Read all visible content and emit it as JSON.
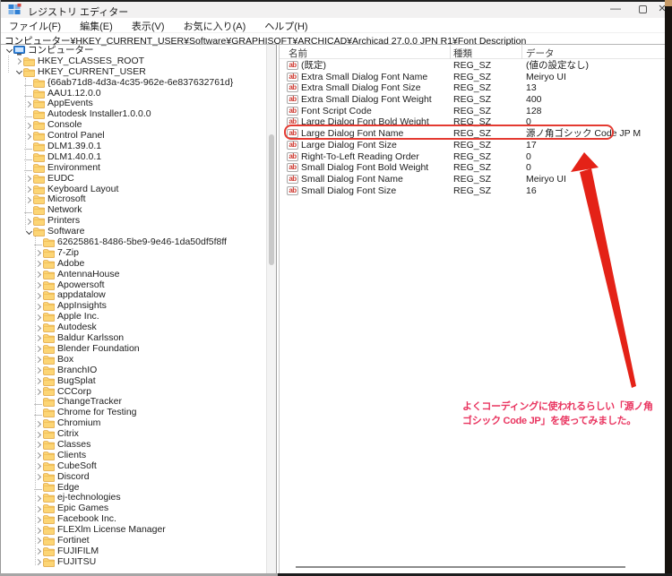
{
  "window": {
    "title": "レジストリ エディター"
  },
  "icons": {
    "minimize": "—",
    "close": "✕",
    "reg_sz": "ab"
  },
  "menu": {
    "items": [
      "ファイル(F)",
      "編集(E)",
      "表示(V)",
      "お気に入り(A)",
      "ヘルプ(H)"
    ]
  },
  "address_bar": {
    "value": "コンピューター¥HKEY_CURRENT_USER¥Software¥GRAPHISOFT¥ARCHICAD¥Archicad 27.0.0 JPN R1¥Font Description"
  },
  "tree": {
    "items": [
      {
        "label": "コンピューター",
        "level": 0,
        "expander": "expanded",
        "icon": "computer"
      },
      {
        "label": "HKEY_CLASSES_ROOT",
        "level": 1,
        "expander": "collapsed",
        "icon": "folder"
      },
      {
        "label": "HKEY_CURRENT_USER",
        "level": 1,
        "expander": "expanded",
        "icon": "folder"
      },
      {
        "label": "{66ab71d8-4d3a-4c35-962e-6e837632761d}",
        "level": 2,
        "expander": "none",
        "icon": "folder"
      },
      {
        "label": "AAU1.12.0.0",
        "level": 2,
        "expander": "none",
        "icon": "folder"
      },
      {
        "label": "AppEvents",
        "level": 2,
        "expander": "collapsed",
        "icon": "folder"
      },
      {
        "label": "Autodesk Installer1.0.0.0",
        "level": 2,
        "expander": "none",
        "icon": "folder"
      },
      {
        "label": "Console",
        "level": 2,
        "expander": "collapsed",
        "icon": "folder"
      },
      {
        "label": "Control Panel",
        "level": 2,
        "expander": "collapsed",
        "icon": "folder"
      },
      {
        "label": "DLM1.39.0.1",
        "level": 2,
        "expander": "none",
        "icon": "folder"
      },
      {
        "label": "DLM1.40.0.1",
        "level": 2,
        "expander": "none",
        "icon": "folder"
      },
      {
        "label": "Environment",
        "level": 2,
        "expander": "none",
        "icon": "folder"
      },
      {
        "label": "EUDC",
        "level": 2,
        "expander": "collapsed",
        "icon": "folder"
      },
      {
        "label": "Keyboard Layout",
        "level": 2,
        "expander": "collapsed",
        "icon": "folder"
      },
      {
        "label": "Microsoft",
        "level": 2,
        "expander": "collapsed",
        "icon": "folder"
      },
      {
        "label": "Network",
        "level": 2,
        "expander": "none",
        "icon": "folder"
      },
      {
        "label": "Printers",
        "level": 2,
        "expander": "collapsed",
        "icon": "folder"
      },
      {
        "label": "Software",
        "level": 2,
        "expander": "expanded",
        "icon": "folder"
      },
      {
        "label": "62625861-8486-5be9-9e46-1da50df5f8ff",
        "level": 3,
        "expander": "none",
        "icon": "folder"
      },
      {
        "label": "7-Zip",
        "level": 3,
        "expander": "collapsed",
        "icon": "folder"
      },
      {
        "label": "Adobe",
        "level": 3,
        "expander": "collapsed",
        "icon": "folder"
      },
      {
        "label": "AntennaHouse",
        "level": 3,
        "expander": "collapsed",
        "icon": "folder"
      },
      {
        "label": "Apowersoft",
        "level": 3,
        "expander": "collapsed",
        "icon": "folder"
      },
      {
        "label": "appdatalow",
        "level": 3,
        "expander": "collapsed",
        "icon": "folder"
      },
      {
        "label": "AppInsights",
        "level": 3,
        "expander": "collapsed",
        "icon": "folder"
      },
      {
        "label": "Apple Inc.",
        "level": 3,
        "expander": "collapsed",
        "icon": "folder"
      },
      {
        "label": "Autodesk",
        "level": 3,
        "expander": "collapsed",
        "icon": "folder"
      },
      {
        "label": "Baldur Karlsson",
        "level": 3,
        "expander": "collapsed",
        "icon": "folder"
      },
      {
        "label": "Blender Foundation",
        "level": 3,
        "expander": "collapsed",
        "icon": "folder"
      },
      {
        "label": "Box",
        "level": 3,
        "expander": "collapsed",
        "icon": "folder"
      },
      {
        "label": "BranchIO",
        "level": 3,
        "expander": "collapsed",
        "icon": "folder"
      },
      {
        "label": "BugSplat",
        "level": 3,
        "expander": "collapsed",
        "icon": "folder"
      },
      {
        "label": "CCCorp",
        "level": 3,
        "expander": "collapsed",
        "icon": "folder"
      },
      {
        "label": "ChangeTracker",
        "level": 3,
        "expander": "none",
        "icon": "folder"
      },
      {
        "label": "Chrome for Testing",
        "level": 3,
        "expander": "none",
        "icon": "folder"
      },
      {
        "label": "Chromium",
        "level": 3,
        "expander": "collapsed",
        "icon": "folder"
      },
      {
        "label": "Citrix",
        "level": 3,
        "expander": "collapsed",
        "icon": "folder"
      },
      {
        "label": "Classes",
        "level": 3,
        "expander": "collapsed",
        "icon": "folder"
      },
      {
        "label": "Clients",
        "level": 3,
        "expander": "collapsed",
        "icon": "folder"
      },
      {
        "label": "CubeSoft",
        "level": 3,
        "expander": "collapsed",
        "icon": "folder"
      },
      {
        "label": "Discord",
        "level": 3,
        "expander": "collapsed",
        "icon": "folder"
      },
      {
        "label": "Edge",
        "level": 3,
        "expander": "none",
        "icon": "folder"
      },
      {
        "label": "ej-technologies",
        "level": 3,
        "expander": "collapsed",
        "icon": "folder"
      },
      {
        "label": "Epic Games",
        "level": 3,
        "expander": "collapsed",
        "icon": "folder"
      },
      {
        "label": "Facebook Inc.",
        "level": 3,
        "expander": "collapsed",
        "icon": "folder"
      },
      {
        "label": "FLEXlm License Manager",
        "level": 3,
        "expander": "collapsed",
        "icon": "folder"
      },
      {
        "label": "Fortinet",
        "level": 3,
        "expander": "collapsed",
        "icon": "folder"
      },
      {
        "label": "FUJIFILM",
        "level": 3,
        "expander": "collapsed",
        "icon": "folder"
      },
      {
        "label": "FUJITSU",
        "level": 3,
        "expander": "collapsed",
        "icon": "folder"
      }
    ]
  },
  "values_table": {
    "columns": [
      "名前",
      "種類",
      "データ"
    ],
    "rows": [
      {
        "name": "(既定)",
        "type": "REG_SZ",
        "data": "(値の設定なし)",
        "highlighted": false
      },
      {
        "name": "Extra Small Dialog Font Name",
        "type": "REG_SZ",
        "data": "Meiryo UI",
        "highlighted": false
      },
      {
        "name": "Extra Small Dialog Font Size",
        "type": "REG_SZ",
        "data": "13",
        "highlighted": false
      },
      {
        "name": "Extra Small Dialog Font Weight",
        "type": "REG_SZ",
        "data": "400",
        "highlighted": false
      },
      {
        "name": "Font Script Code",
        "type": "REG_SZ",
        "data": "128",
        "highlighted": false
      },
      {
        "name": "Large Dialog Font Bold Weight",
        "type": "REG_SZ",
        "data": "0",
        "highlighted": false
      },
      {
        "name": "Large Dialog Font Name",
        "type": "REG_SZ",
        "data": "源ノ角ゴシック Code JP M",
        "highlighted": true
      },
      {
        "name": "Large Dialog Font Size",
        "type": "REG_SZ",
        "data": "17",
        "highlighted": false
      },
      {
        "name": "Right-To-Left Reading Order",
        "type": "REG_SZ",
        "data": "0",
        "highlighted": false
      },
      {
        "name": "Small Dialog Font Bold Weight",
        "type": "REG_SZ",
        "data": "0",
        "highlighted": false
      },
      {
        "name": "Small Dialog Font Name",
        "type": "REG_SZ",
        "data": "Meiryo UI",
        "highlighted": false
      },
      {
        "name": "Small Dialog Font Size",
        "type": "REG_SZ",
        "data": "16",
        "highlighted": false
      }
    ]
  },
  "annotation": {
    "lines": [
      "よくコーディングに使われるらしい「源ノ角",
      "ゴシック Code JP」を使ってみました。"
    ],
    "text_color": "#e93560",
    "arrow_color": "#e42217",
    "box_color": "#e43a31"
  }
}
